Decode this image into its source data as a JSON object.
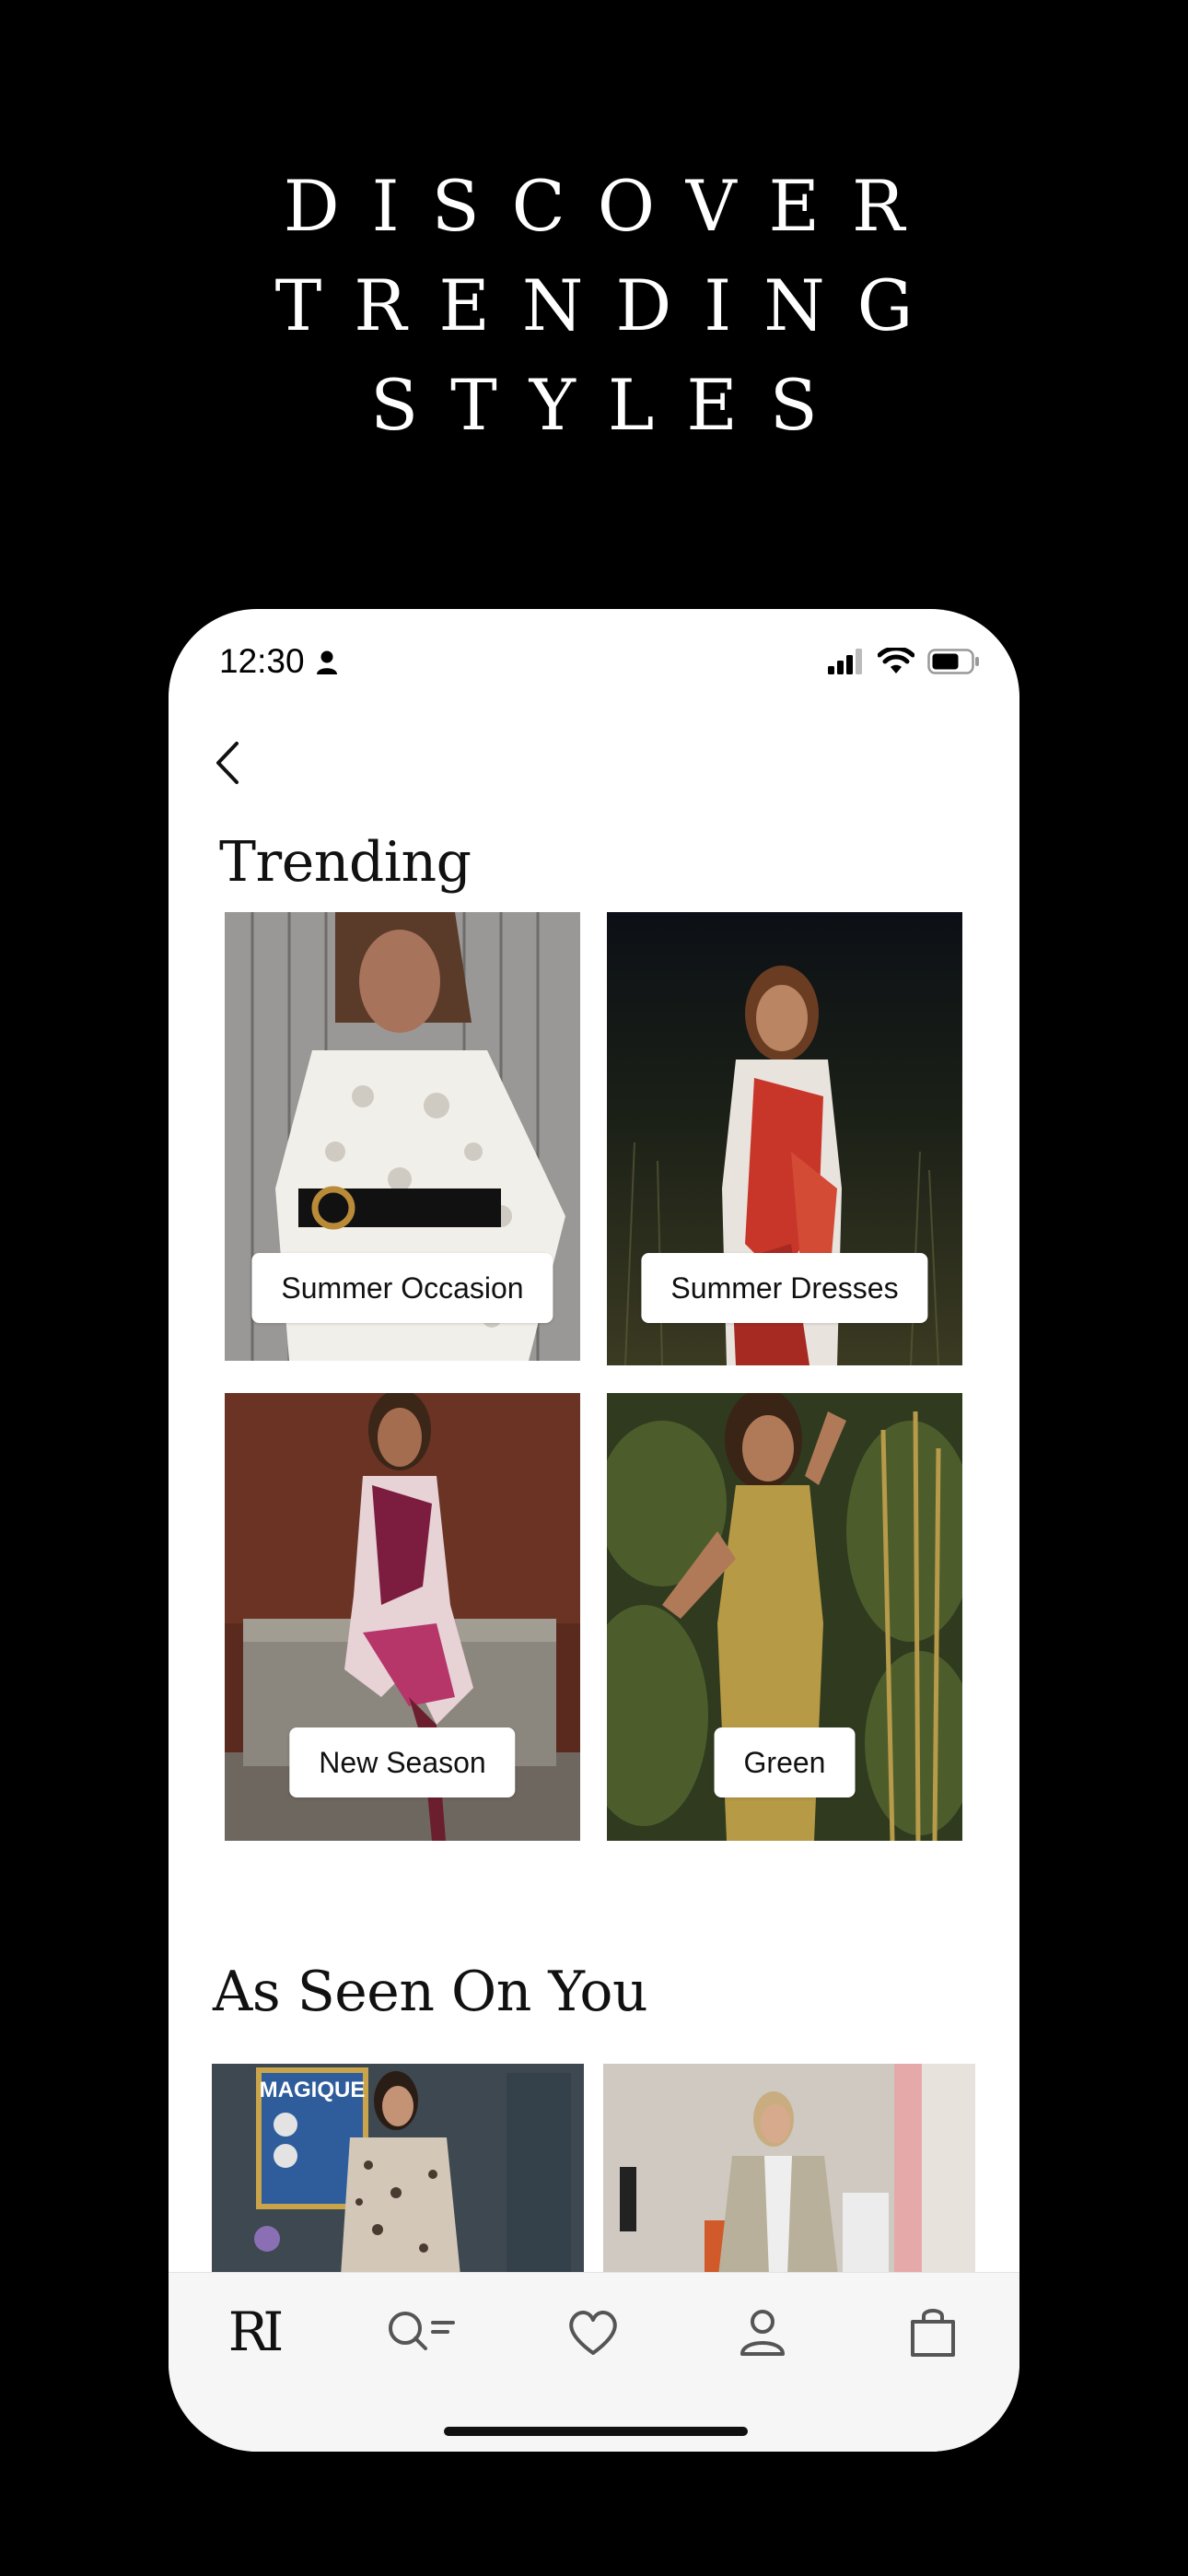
{
  "headline": {
    "line1": "DISCOVER",
    "line2": "TRENDING",
    "line3": "STYLES"
  },
  "status_bar": {
    "time": "12:30"
  },
  "trending": {
    "title": "Trending",
    "cards": [
      {
        "label": "Summer Occasion"
      },
      {
        "label": "Summer Dresses"
      },
      {
        "label": "New Season"
      },
      {
        "label": "Green"
      }
    ]
  },
  "as_seen_on_you": {
    "title": "As Seen On You",
    "poster_text": "MAGIQUE"
  },
  "tab_bar": {
    "logo": "RI",
    "tabs": [
      "home",
      "search",
      "wishlist",
      "account",
      "bag"
    ]
  },
  "colors": {
    "background": "#000000",
    "screen": "#ffffff",
    "tabbar": "#f6f6f6"
  }
}
